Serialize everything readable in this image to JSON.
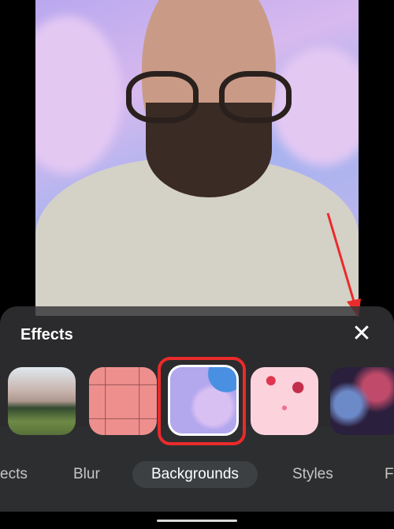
{
  "panel": {
    "title": "Effects",
    "close_icon": "close-icon",
    "backgrounds": [
      {
        "name": "mountains",
        "selected": false
      },
      {
        "name": "pink-wall",
        "selected": false
      },
      {
        "name": "purple-clouds",
        "selected": true
      },
      {
        "name": "confetti",
        "selected": false
      },
      {
        "name": "fireworks",
        "selected": false
      }
    ],
    "tabs": [
      {
        "label": "ects",
        "active": false
      },
      {
        "label": "Blur",
        "active": false
      },
      {
        "label": "Backgrounds",
        "active": true
      },
      {
        "label": "Styles",
        "active": false
      },
      {
        "label": "F",
        "active": false
      }
    ]
  },
  "colors": {
    "annotation": "#ea2b2b",
    "panel": "#2d2e30",
    "active_tab": "#3c4043"
  }
}
